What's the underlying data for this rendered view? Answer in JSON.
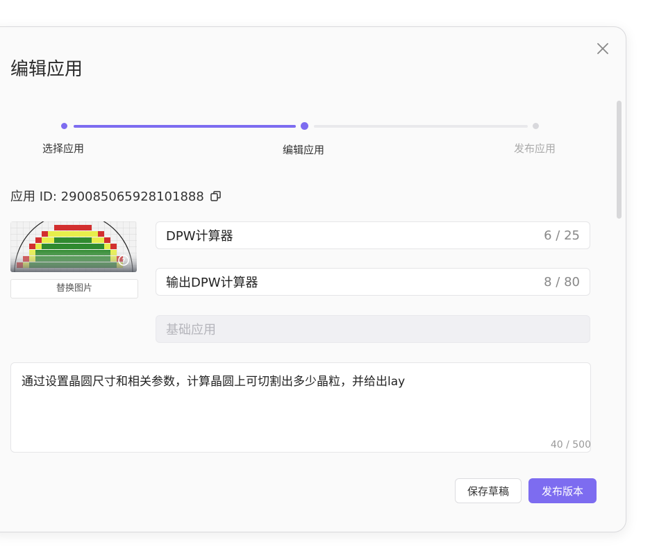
{
  "dialog": {
    "title": "编辑应用",
    "close_icon": "close-icon"
  },
  "steps": [
    {
      "label": "选择应用",
      "state": "done"
    },
    {
      "label": "编辑应用",
      "state": "active"
    },
    {
      "label": "发布应用",
      "state": "pending"
    }
  ],
  "app_id": {
    "text": "应用 ID: 290085065928101888",
    "copy_icon": "copy-icon"
  },
  "image": {
    "replace_label": "替换图片",
    "help_icon": "question-icon"
  },
  "fields": {
    "name": {
      "value": "DPW计算器",
      "count": "6 / 25"
    },
    "subtitle": {
      "value": "输出DPW计算器",
      "count": "8 / 80"
    },
    "category": {
      "value": "基础应用"
    }
  },
  "description": {
    "value": "通过设置晶圆尺寸和相关参数，计算晶圆上可切割出多少晶粒，并给出lay",
    "count": "40 / 500"
  },
  "actions": {
    "draft_label": "保存草稿",
    "publish_label": "发布版本"
  },
  "colors": {
    "accent": "#7d6cf0",
    "inactive": "#e9e9ec"
  }
}
